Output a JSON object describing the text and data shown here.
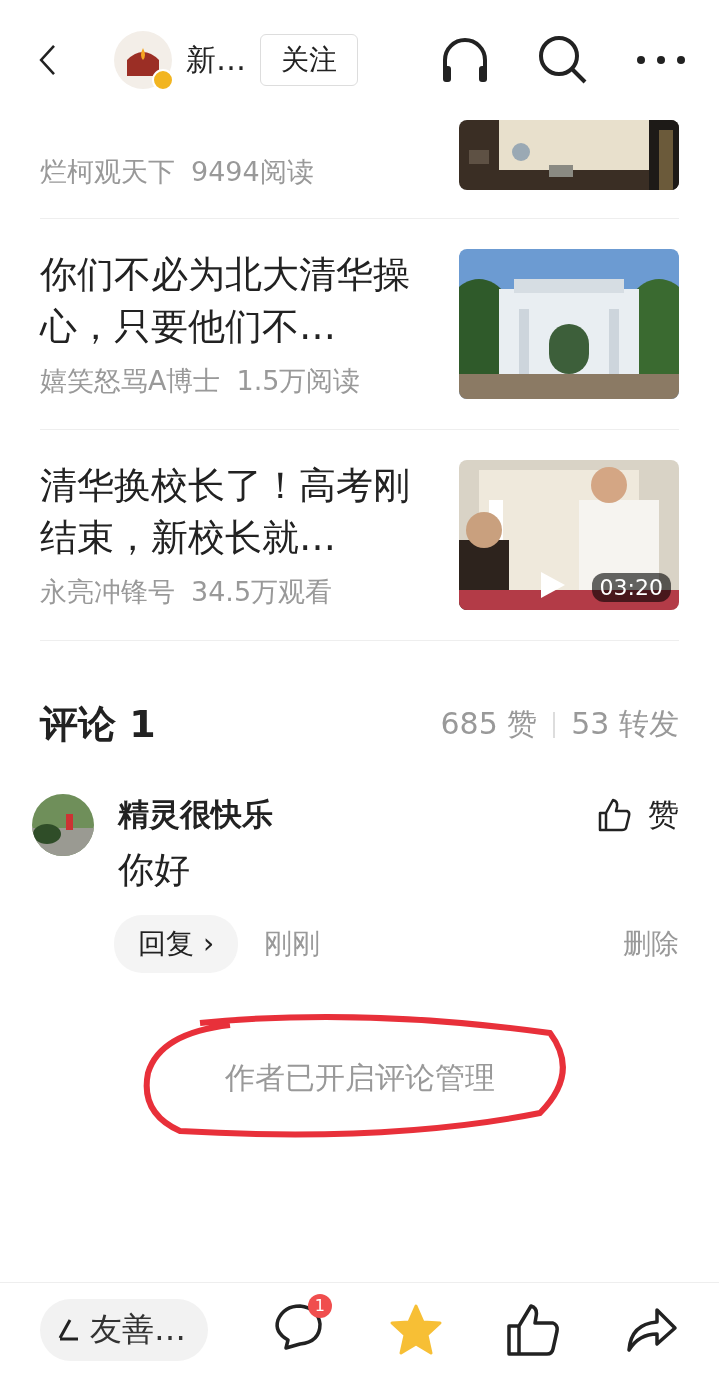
{
  "header": {
    "account_name": "新…",
    "follow_button": "关注",
    "verified": true
  },
  "articles": [
    {
      "kind": "partial",
      "source": "烂柯观天下",
      "stats": "9494阅读"
    },
    {
      "kind": "article",
      "title": "你们不必为北大清华操心，只要他们不…",
      "source": "嬉笑怒骂A博士",
      "stats": "1.5万阅读"
    },
    {
      "kind": "video",
      "title": "清华换校长了！高考刚结束，新校长就…",
      "source": "永亮冲锋号",
      "stats": "34.5万观看",
      "thumbnail": {
        "kind": "picture",
        "duration": "03:20"
      }
    }
  ],
  "comments_section": {
    "title": "评论 1",
    "likes": "685 赞",
    "shares": "53 转发"
  },
  "comments": [
    {
      "author": "精灵很快乐",
      "text": "你好",
      "like_label": "赞",
      "reply_button": "回复",
      "reply_chevron": "›",
      "time": "刚刚",
      "delete_button": "删除"
    }
  ],
  "notice": {
    "text": "作者已开启评论管理",
    "circled": true
  },
  "bottom_bar": {
    "input_placeholder": "友善…",
    "comment_badge": "1",
    "favorited": true
  }
}
